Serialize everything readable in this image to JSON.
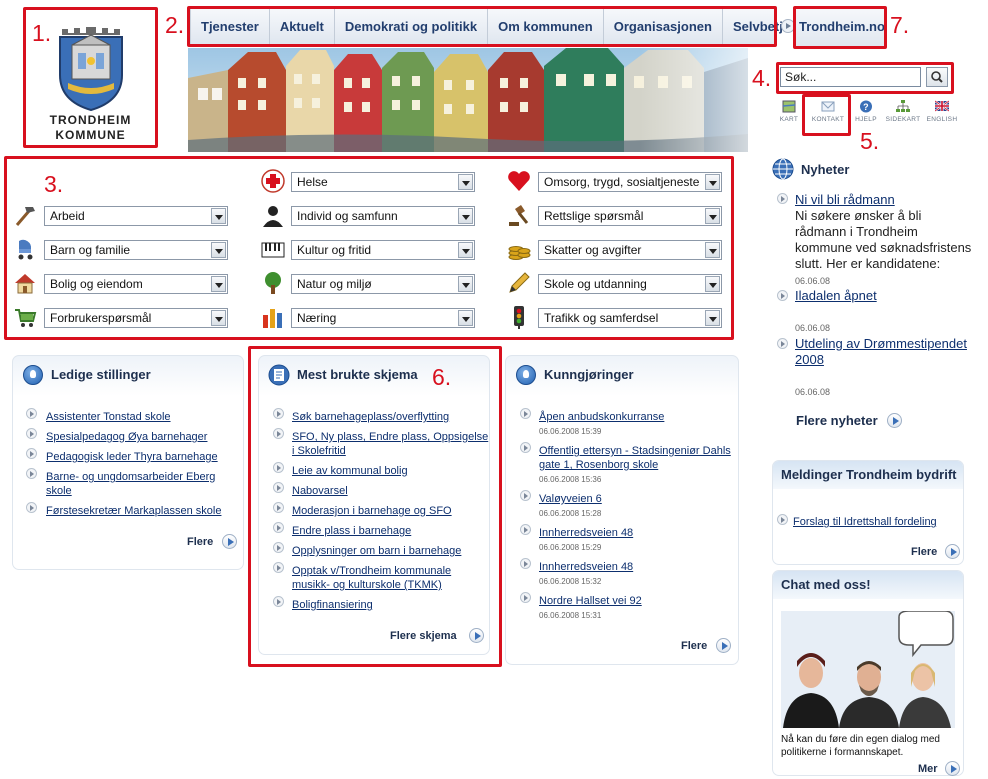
{
  "annotations": [
    "1.",
    "2.",
    "3.",
    "4.",
    "5.",
    "6.",
    "7."
  ],
  "logo": {
    "line1": "TRONDHEIM",
    "line2": "KOMMUNE"
  },
  "nav": {
    "items": [
      "Tjenester",
      "Aktuelt",
      "Demokrati og politikk",
      "Om kommunen",
      "Organisasjonen",
      "Selvbetjening"
    ],
    "external": "Trondheim.no"
  },
  "search": {
    "value": "Søk..."
  },
  "utility": [
    {
      "label": "KART",
      "icon": "map-icon"
    },
    {
      "label": "KONTAKT",
      "icon": "envelope-icon"
    },
    {
      "label": "HJELP",
      "icon": "help-icon"
    },
    {
      "label": "SIDEKART",
      "icon": "sitemap-icon"
    },
    {
      "label": "ENGLISH",
      "icon": "uk-flag-icon"
    }
  ],
  "categories": {
    "col1": [
      {
        "label": "Arbeid",
        "icon": "hammer-icon"
      },
      {
        "label": "Barn og familie",
        "icon": "stroller-icon"
      },
      {
        "label": "Bolig og eiendom",
        "icon": "house-icon"
      },
      {
        "label": "Forbrukerspørsmål",
        "icon": "shopping-cart-icon"
      }
    ],
    "col2": [
      {
        "label": "Helse",
        "icon": "red-cross-icon"
      },
      {
        "label": "Individ og samfunn",
        "icon": "person-icon"
      },
      {
        "label": "Kultur og fritid",
        "icon": "piano-icon"
      },
      {
        "label": "Natur og miljø",
        "icon": "tree-icon"
      },
      {
        "label": "Næring",
        "icon": "bar-chart-icon"
      }
    ],
    "col3": [
      {
        "label": "Omsorg, trygd, sosialtjeneste",
        "icon": "heart-icon"
      },
      {
        "label": "Rettslige spørsmål",
        "icon": "gavel-icon"
      },
      {
        "label": "Skatter og avgifter",
        "icon": "coins-icon"
      },
      {
        "label": "Skole og utdanning",
        "icon": "pencil-icon"
      },
      {
        "label": "Trafikk og samferdsel",
        "icon": "traffic-light-icon"
      }
    ]
  },
  "ledige": {
    "title": "Ledige stillinger",
    "items": [
      "Assistenter Tonstad skole",
      "Spesialpedagog Øya barnehager",
      "Pedagogisk leder Thyra barnehage",
      "Barne- og ungdomsarbeider Eberg skole",
      "Førstesekretær Markaplassen skole"
    ],
    "more": "Flere"
  },
  "skjema": {
    "title": "Mest brukte skjema",
    "items": [
      "Søk barnehageplass/overflytting",
      "SFO, Ny plass, Endre plass, Oppsigelse i Skolefritid",
      "Leie av kommunal bolig",
      "Nabovarsel",
      "Moderasjon i barnehage og SFO",
      "Endre plass i barnehage",
      "Opplysninger om barn i barnehage",
      "Opptak v/Trondheim kommunale musikk- og kulturskole (TKMK)",
      "Boligfinansiering"
    ],
    "more": "Flere skjema"
  },
  "kunngjoringer": {
    "title": "Kunngjøringer",
    "items": [
      {
        "text": "Åpen anbudskonkurranse",
        "date": "06.06.2008 15:39"
      },
      {
        "text": "Offentlig ettersyn - Stadsingeniør Dahls gate 1, Rosenborg skole",
        "date": "06.06.2008 15:36"
      },
      {
        "text": "Valøyveien 6",
        "date": "06.06.2008 15:28"
      },
      {
        "text": "Innherredsveien 48",
        "date": "06.06.2008 15:29"
      },
      {
        "text": "Innherredsveien 48",
        "date": "06.06.2008 15:32"
      },
      {
        "text": "Nordre Hallset vei 92",
        "date": "06.06.2008 15:31"
      }
    ],
    "more": "Flere"
  },
  "nyheter": {
    "title": "Nyheter",
    "items": [
      {
        "title": "Ni vil bli rådmann",
        "text": "Ni søkere ønsker å bli rådmann i Trondheim kommune ved søknadsfristens slutt. Her er kandidatene:",
        "date": "06.06.08"
      },
      {
        "title": "Iladalen åpnet",
        "date": "06.06.08"
      },
      {
        "title": "Utdeling av Drømmestipendet 2008",
        "date": "06.06.08"
      }
    ],
    "more": "Flere nyheter"
  },
  "meldinger": {
    "title": "Meldinger Trondheim bydrift",
    "items": [
      "Forslag til Idrettshall fordeling"
    ],
    "more": "Flere"
  },
  "chat": {
    "title": "Chat med oss!",
    "text": "Nå kan du føre din egen dialog med politikerne i formannskapet.",
    "more": "Mer"
  },
  "colors": {
    "annotation": "#d8101e",
    "link": "#0d2f6e",
    "heading": "#1d2f4e"
  }
}
